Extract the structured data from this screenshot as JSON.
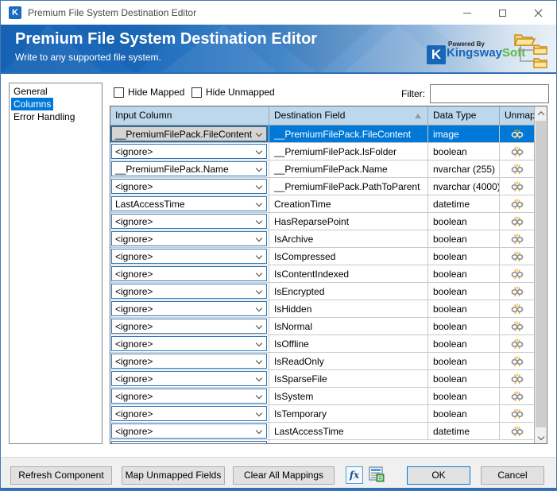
{
  "window": {
    "title": "Premium File System Destination Editor",
    "icon_letter": "K"
  },
  "header": {
    "title": "Premium File System Destination Editor",
    "subtitle": "Write to any supported file system.",
    "logo": {
      "k_letter": "K",
      "powered_by": "Powered By",
      "brand_kingsway": "Kingsway",
      "brand_soft": "Soft"
    }
  },
  "sidebar": {
    "items": [
      {
        "label": "General",
        "selected": false
      },
      {
        "label": "Columns",
        "selected": true
      },
      {
        "label": "Error Handling",
        "selected": false
      }
    ]
  },
  "toolbar": {
    "hide_mapped_label": "Hide Mapped",
    "hide_mapped_checked": false,
    "hide_unmapped_label": "Hide Unmapped",
    "hide_unmapped_checked": false,
    "filter_label": "Filter:",
    "filter_value": ""
  },
  "table": {
    "headers": {
      "input_column": "Input Column",
      "destination_field": "Destination Field",
      "data_type": "Data Type",
      "unmap": "Unmap"
    },
    "sorted_column": "Destination Field",
    "sort_direction": "ascending",
    "rows": [
      {
        "input": "__PremiumFilePack.FileContent",
        "destination": "__PremiumFilePack.FileContent",
        "data_type": "image",
        "selected": true
      },
      {
        "input": "<ignore>",
        "destination": "__PremiumFilePack.IsFolder",
        "data_type": "boolean",
        "selected": false
      },
      {
        "input": "__PremiumFilePack.Name",
        "destination": "__PremiumFilePack.Name",
        "data_type": "nvarchar (255)",
        "selected": false
      },
      {
        "input": "<ignore>",
        "destination": "__PremiumFilePack.PathToParent",
        "data_type": "nvarchar (4000)",
        "selected": false
      },
      {
        "input": "LastAccessTime",
        "destination": "CreationTime",
        "data_type": "datetime",
        "selected": false
      },
      {
        "input": "<ignore>",
        "destination": "HasReparsePoint",
        "data_type": "boolean",
        "selected": false
      },
      {
        "input": "<ignore>",
        "destination": "IsArchive",
        "data_type": "boolean",
        "selected": false
      },
      {
        "input": "<ignore>",
        "destination": "IsCompressed",
        "data_type": "boolean",
        "selected": false
      },
      {
        "input": "<ignore>",
        "destination": "IsContentIndexed",
        "data_type": "boolean",
        "selected": false
      },
      {
        "input": "<ignore>",
        "destination": "IsEncrypted",
        "data_type": "boolean",
        "selected": false
      },
      {
        "input": "<ignore>",
        "destination": "IsHidden",
        "data_type": "boolean",
        "selected": false
      },
      {
        "input": "<ignore>",
        "destination": "IsNormal",
        "data_type": "boolean",
        "selected": false
      },
      {
        "input": "<ignore>",
        "destination": "IsOffline",
        "data_type": "boolean",
        "selected": false
      },
      {
        "input": "<ignore>",
        "destination": "IsReadOnly",
        "data_type": "boolean",
        "selected": false
      },
      {
        "input": "<ignore>",
        "destination": "IsSparseFile",
        "data_type": "boolean",
        "selected": false
      },
      {
        "input": "<ignore>",
        "destination": "IsSystem",
        "data_type": "boolean",
        "selected": false
      },
      {
        "input": "<ignore>",
        "destination": "IsTemporary",
        "data_type": "boolean",
        "selected": false
      },
      {
        "input": "<ignore>",
        "destination": "LastAccessTime",
        "data_type": "datetime",
        "selected": false
      }
    ]
  },
  "footer": {
    "refresh_label": "Refresh Component",
    "map_unmapped_label": "Map Unmapped Fields",
    "clear_all_label": "Clear All Mappings",
    "fx_label": "fx",
    "ok_label": "OK",
    "cancel_label": "Cancel"
  },
  "colors": {
    "accent": "#0078d7",
    "banner_blue_start": "#1561b3",
    "banner_blue_end": "#e9f0f7",
    "grid_header_bg": "#bdd8ec",
    "selected_row_bg": "#0078d7",
    "combobox_border": "#2e75b6",
    "brand_blue": "#1766b8",
    "brand_green": "#58b947",
    "folder_yellow": "#f5d76e",
    "spark_orange": "#f39c12"
  }
}
